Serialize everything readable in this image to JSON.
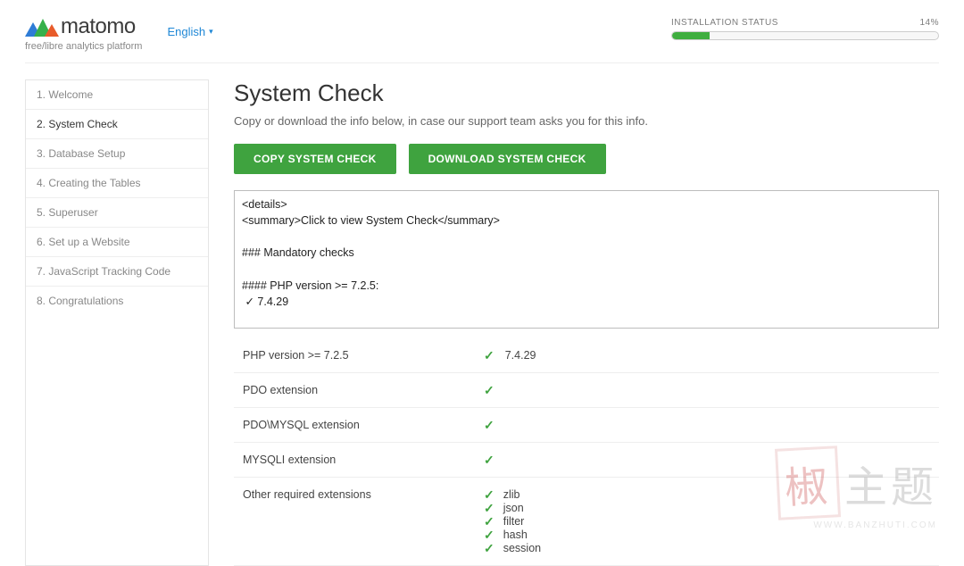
{
  "brand": {
    "wordmark": "matomo",
    "tagline": "free/libre analytics platform"
  },
  "language": {
    "current": "English"
  },
  "install_status": {
    "label": "INSTALLATION STATUS",
    "percent_text": "14%",
    "percent_value": 14
  },
  "sidebar": {
    "steps": [
      {
        "label": "1. Welcome",
        "active": false
      },
      {
        "label": "2. System Check",
        "active": true
      },
      {
        "label": "3. Database Setup",
        "active": false
      },
      {
        "label": "4. Creating the Tables",
        "active": false
      },
      {
        "label": "5. Superuser",
        "active": false
      },
      {
        "label": "6. Set up a Website",
        "active": false
      },
      {
        "label": "7. JavaScript Tracking Code",
        "active": false
      },
      {
        "label": "8. Congratulations",
        "active": false
      }
    ]
  },
  "main": {
    "title": "System Check",
    "subtitle": "Copy or download the info below, in case our support team asks you for this info.",
    "buttons": {
      "copy": "COPY SYSTEM CHECK",
      "download": "DOWNLOAD SYSTEM CHECK"
    },
    "details_text": "<details>\n<summary>Click to view System Check</summary>\n\n### Mandatory checks\n\n#### PHP version >= 7.2.5:\n ✓ 7.4.29\n\n#### PDO extension:\n ✓\n\n#### PDO\\MYSQL extension:",
    "checks": [
      {
        "label": "PHP version >= 7.2.5",
        "value": "7.4.29",
        "ok": true
      },
      {
        "label": "PDO extension",
        "value": "",
        "ok": true
      },
      {
        "label": "PDO\\MYSQL extension",
        "value": "",
        "ok": true
      },
      {
        "label": "MYSQLI extension",
        "value": "",
        "ok": true
      }
    ],
    "other_extensions": {
      "label": "Other required extensions",
      "items": [
        {
          "name": "zlib",
          "ok": true
        },
        {
          "name": "json",
          "ok": true
        },
        {
          "name": "filter",
          "ok": true
        },
        {
          "name": "hash",
          "ok": true
        },
        {
          "name": "session",
          "ok": true
        }
      ]
    }
  },
  "watermark": {
    "stamp": "椒",
    "text_gray": "主题",
    "url": "WWW.BANZHUTI.COM"
  }
}
